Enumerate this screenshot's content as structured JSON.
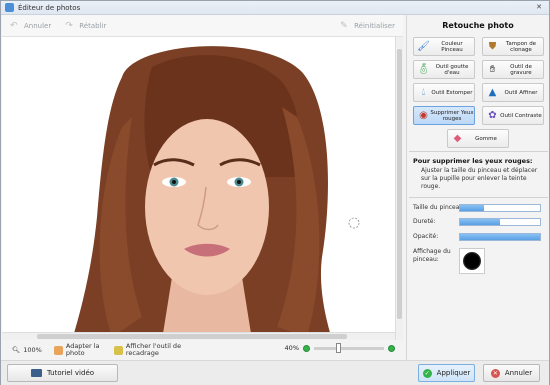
{
  "window": {
    "title": "Éditeur de photos"
  },
  "toolbar": {
    "undo_label": "Annuler",
    "redo_label": "Rétablir",
    "reset_label": "Réinitialiser"
  },
  "status": {
    "zoom": "100%",
    "fit_label": "Adapter la photo",
    "show_crop_label": "Afficher l'outil de recadrage",
    "zoom_percent": "40%"
  },
  "bottom": {
    "tutorial_label": "Tutoriel vidéo",
    "apply_label": "Appliquer",
    "cancel_label": "Annuler"
  },
  "panel": {
    "title": "Retouche photo",
    "tools": [
      {
        "label": "Couleur Pinceau",
        "icon": "brush-color-icon"
      },
      {
        "label": "Tampon de clonage",
        "icon": "clone-stamp-icon"
      },
      {
        "label": "Outil goutte d'eau",
        "icon": "water-drop-icon"
      },
      {
        "label": "Outil de gravure",
        "icon": "burn-tool-icon"
      },
      {
        "label": "Outil Estomper",
        "icon": "blur-icon"
      },
      {
        "label": "Outil Affiner",
        "icon": "sharpen-icon"
      },
      {
        "label": "Supprimer Yeux rouges",
        "icon": "red-eye-icon"
      },
      {
        "label": "Outil Contraste",
        "icon": "contrast-icon"
      },
      {
        "label": "Gomme",
        "icon": "eraser-icon"
      }
    ],
    "description_title": "Pour supprimer les yeux rouges:",
    "description": "Ajuster la taille du pinceau et déplacer sur la pupille pour enlever la teinte rouge.",
    "params": {
      "size_label": "Taille du pinceau:",
      "hardness_label": "Dureté:",
      "opacity_label": "Opacité:",
      "brush_display_label": "Affichage du pinceau:"
    },
    "param_values": {
      "size": 0.3,
      "hardness": 0.5,
      "opacity": 1.0
    }
  },
  "colors": {
    "accent": "#5aa0e3",
    "apply_green": "#35b24a",
    "active_tool": "#bcd8f7"
  }
}
